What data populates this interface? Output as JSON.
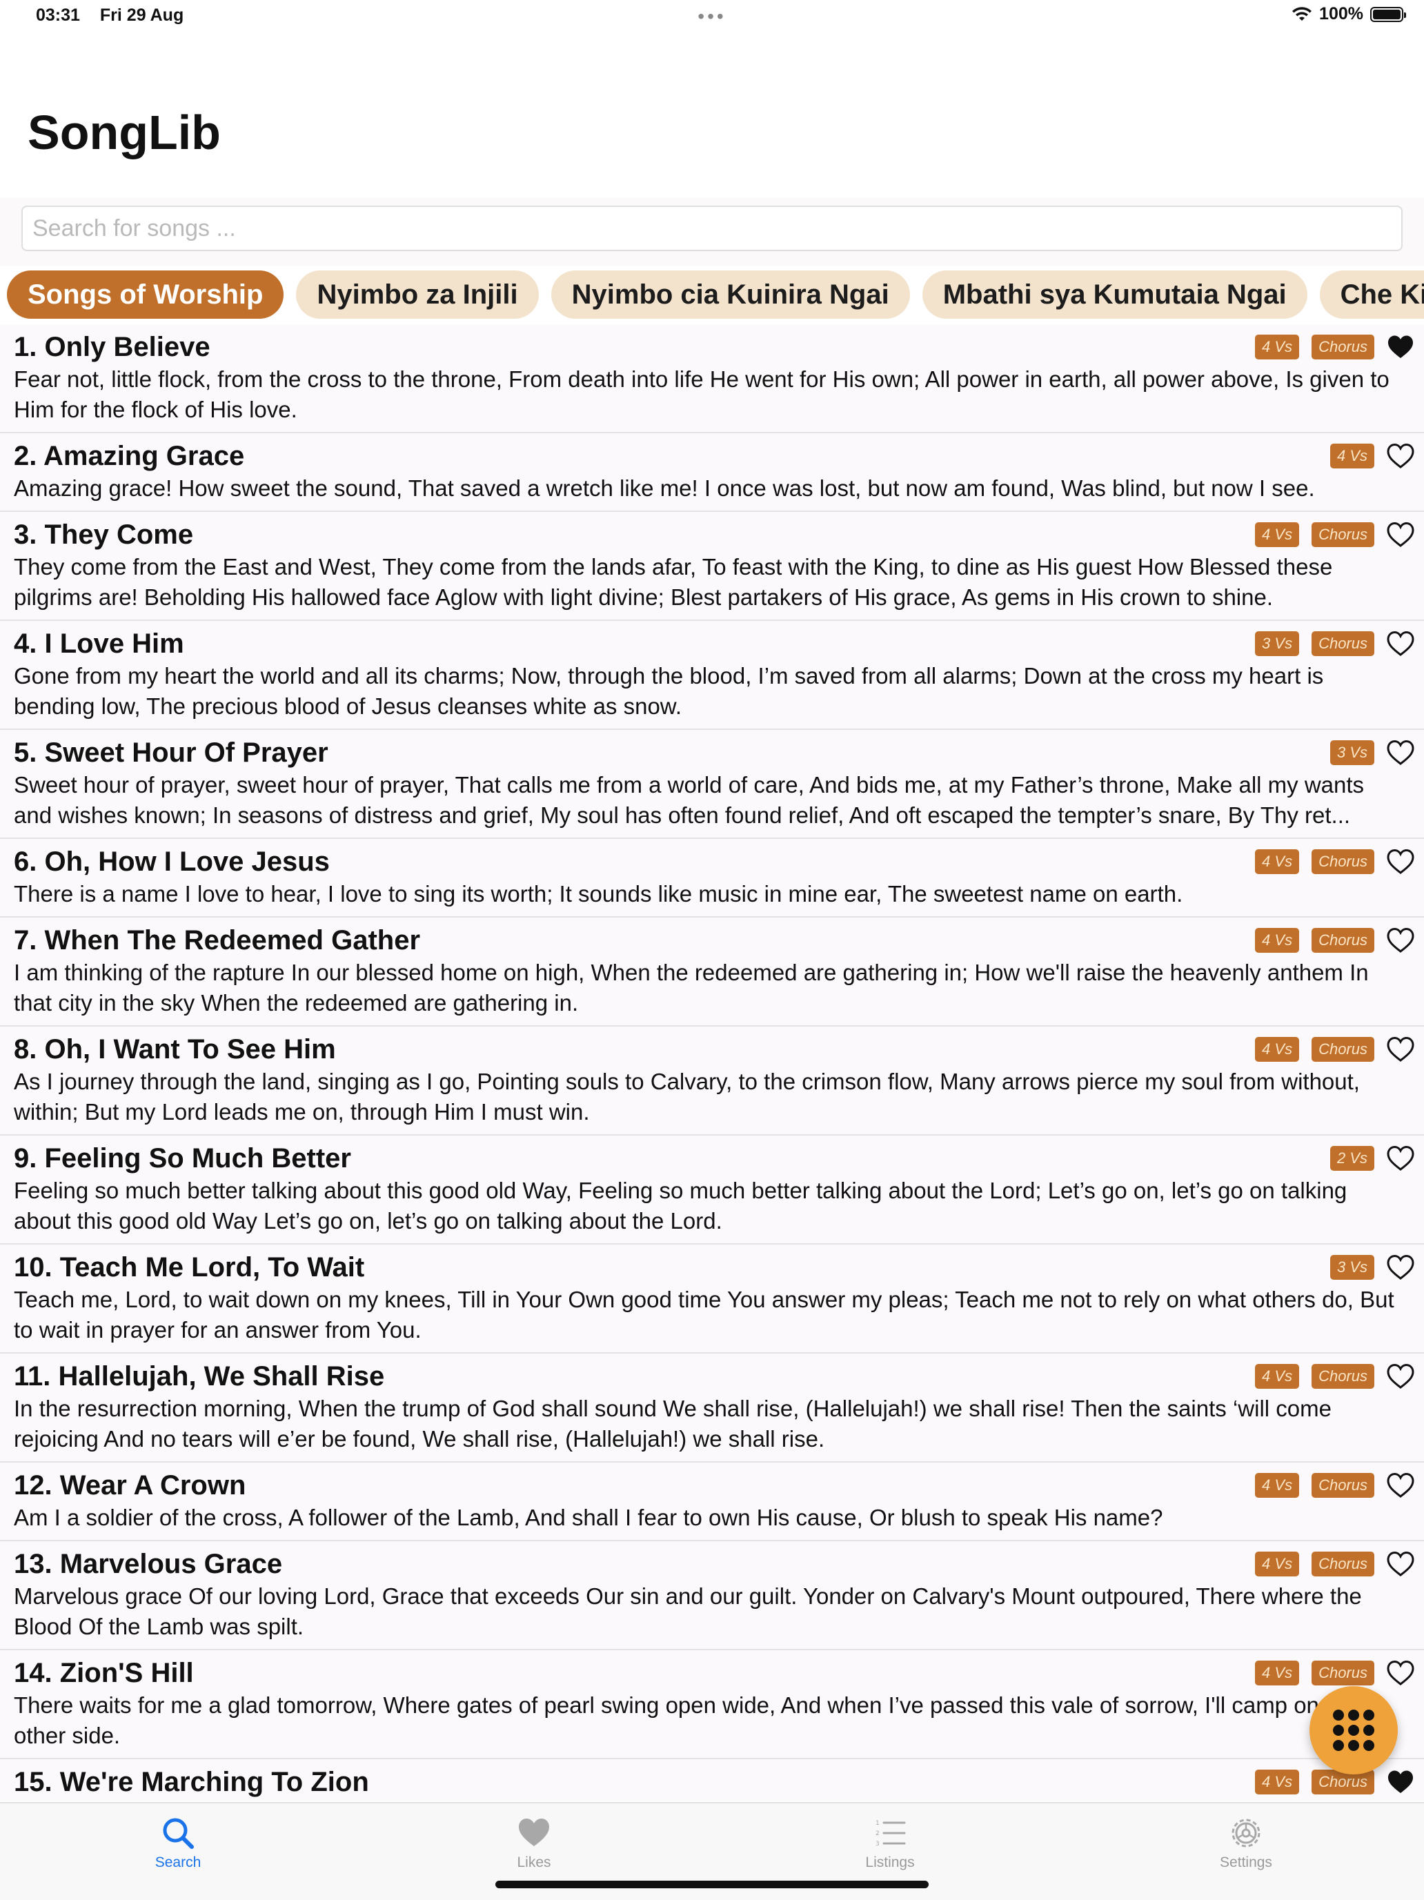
{
  "status": {
    "time": "03:31",
    "date": "Fri 29 Aug",
    "battery": "100%"
  },
  "app": {
    "title": "SongLib"
  },
  "search": {
    "placeholder": "Search for songs ..."
  },
  "books": [
    {
      "label": "Songs of Worship",
      "active": true
    },
    {
      "label": "Nyimbo za Injili",
      "active": false
    },
    {
      "label": "Nyimbo cia Kuinira Ngai",
      "active": false
    },
    {
      "label": "Mbathi sya Kumutaia Ngai",
      "active": false
    },
    {
      "label": "Che Kilos",
      "active": false
    }
  ],
  "songs": [
    {
      "title": "1. Only Believe",
      "verses": "4 Vs",
      "chorus": "Chorus",
      "liked": true,
      "lyrics": "Fear not, little flock, from the cross to the throne, From death into life He went for His own; All power in earth, all power above, Is given to Him for the flock of His love."
    },
    {
      "title": "2. Amazing Grace",
      "verses": "4 Vs",
      "chorus": "",
      "liked": false,
      "lyrics": "Amazing grace! How sweet the sound, That saved a wretch like me! I once was lost, but now am found, Was blind, but now I see."
    },
    {
      "title": "3. They Come",
      "verses": "4 Vs",
      "chorus": "Chorus",
      "liked": false,
      "lyrics": "They come from the East and West, They come from the lands afar, To feast with the King, to dine as His guest How Blessed these pilgrims are! Beholding His hallowed face Aglow with light divine; Blest partakers of His grace, As gems in His crown to shine."
    },
    {
      "title": "4. I Love Him",
      "verses": "3 Vs",
      "chorus": "Chorus",
      "liked": false,
      "lyrics": "Gone from my heart the world and all its charms; Now, through the blood, I’m saved from all alarms; Down at the cross my heart is bending low, The precious blood of Jesus cleanses white as snow."
    },
    {
      "title": "5. Sweet Hour Of Prayer",
      "verses": "3 Vs",
      "chorus": "",
      "liked": false,
      "lyrics": "Sweet hour of prayer, sweet hour of prayer, That calls me from a world of care, And bids me, at my Father’s throne, Make all my wants and wishes known; In seasons of distress and grief, My soul has often found relief, And oft escaped the tempter’s snare, By Thy ret..."
    },
    {
      "title": "6. Oh, How I Love Jesus",
      "verses": "4 Vs",
      "chorus": "Chorus",
      "liked": false,
      "lyrics": "There is a name I love to hear, I love to sing its worth; It sounds like music in mine ear, The sweetest name on earth."
    },
    {
      "title": "7. When The Redeemed Gather",
      "verses": "4 Vs",
      "chorus": "Chorus",
      "liked": false,
      "lyrics": "I am thinking of the rapture In our blessed home on high, When the redeemed are gathering in; How we'll raise the heavenly anthem In that city in the sky When the redeemed are gathering in."
    },
    {
      "title": "8. Oh, I Want To See Him",
      "verses": "4 Vs",
      "chorus": "Chorus",
      "liked": false,
      "lyrics": "As I journey through the land, singing as I go, Pointing souls to Calvary, to the crimson flow, Many arrows pierce my soul from without, within; But my Lord leads me on, through Him I must win."
    },
    {
      "title": "9. Feeling So Much Better",
      "verses": "2 Vs",
      "chorus": "",
      "liked": false,
      "lyrics": "Feeling so much better talking about this good old Way, Feeling so much better talking about the Lord; Let’s go on, let’s go on talking about this good old Way Let’s go on, let’s go on talking about the Lord."
    },
    {
      "title": "10. Teach Me Lord, To Wait",
      "verses": "3 Vs",
      "chorus": "",
      "liked": false,
      "lyrics": "Teach me, Lord, to wait down on my knees, Till in Your Own good time You answer my pleas; Teach me not to rely on what others do, But to wait in prayer for an answer from You."
    },
    {
      "title": "11. Hallelujah, We Shall Rise",
      "verses": "4 Vs",
      "chorus": "Chorus",
      "liked": false,
      "lyrics": "In the resurrection morning, When the trump of God shall sound We shall rise, (Hallelujah!) we shall rise! Then the saints ‘will come rejoicing And no tears will e’er be found, We shall rise, (Hallelujah!) we shall rise."
    },
    {
      "title": "12. Wear A Crown",
      "verses": "4 Vs",
      "chorus": "Chorus",
      "liked": false,
      "lyrics": "Am I a soldier of the cross, A follower of the Lamb, And shall I fear to own His cause, Or blush to speak His name?"
    },
    {
      "title": "13. Marvelous Grace",
      "verses": "4 Vs",
      "chorus": "Chorus",
      "liked": false,
      "lyrics": "Marvelous grace Of our loving Lord, Grace that exceeds Our sin and our guilt. Yonder on Calvary's Mount outpoured, There where the Blood Of the Lamb was spilt."
    },
    {
      "title": "14. Zion'S Hill",
      "verses": "4 Vs",
      "chorus": "Chorus",
      "liked": false,
      "lyrics": "There waits for me a glad tomorrow, Where gates of pearl swing open wide, And when I’ve passed this vale of sorrow, I'll camp on the other side."
    },
    {
      "title": "15. We're Marching To Zion",
      "verses": "4 Vs",
      "chorus": "Chorus",
      "liked": true,
      "lyrics": ""
    }
  ],
  "tabs": [
    {
      "label": "Search",
      "icon": "search-icon",
      "active": true
    },
    {
      "label": "Likes",
      "icon": "heart-icon",
      "active": false
    },
    {
      "label": "Listings",
      "icon": "list-icon",
      "active": false
    },
    {
      "label": "Settings",
      "icon": "gear-icon",
      "active": false
    }
  ],
  "colors": {
    "accent": "#c0702a",
    "chip_bg": "#f4e3cc",
    "fab": "#f0a23a",
    "tab_active": "#1a73e8"
  }
}
